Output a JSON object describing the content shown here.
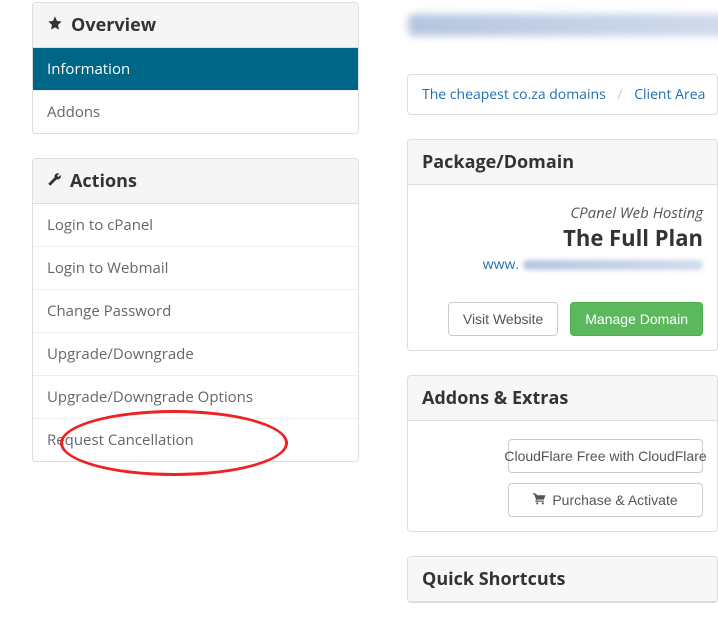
{
  "sidebar": {
    "overview": {
      "header": "Overview",
      "items": [
        {
          "label": "Information",
          "active": true
        },
        {
          "label": "Addons",
          "active": false
        }
      ]
    },
    "actions": {
      "header": "Actions",
      "items": [
        {
          "label": "Login to cPanel"
        },
        {
          "label": "Login to Webmail"
        },
        {
          "label": "Change Password"
        },
        {
          "label": "Upgrade/Downgrade"
        },
        {
          "label": "Upgrade/Downgrade Options"
        },
        {
          "label": "Request Cancellation"
        }
      ]
    }
  },
  "breadcrumb": {
    "items": [
      {
        "label": "The cheapest co.za domains"
      },
      {
        "label": "Client Area"
      }
    ],
    "separator": "/"
  },
  "package": {
    "header": "Package/Domain",
    "hosting_line": "CPanel Web Hosting",
    "plan_name": "The Full Plan",
    "domain_prefix": "www.",
    "visit_label": "Visit Website",
    "manage_label": "Manage Domain"
  },
  "addons": {
    "header": "Addons & Extras",
    "item_label": "CloudFlare Free with CloudFlare",
    "purchase_label": "Purchase & Activate"
  },
  "shortcuts": {
    "header": "Quick Shortcuts"
  }
}
